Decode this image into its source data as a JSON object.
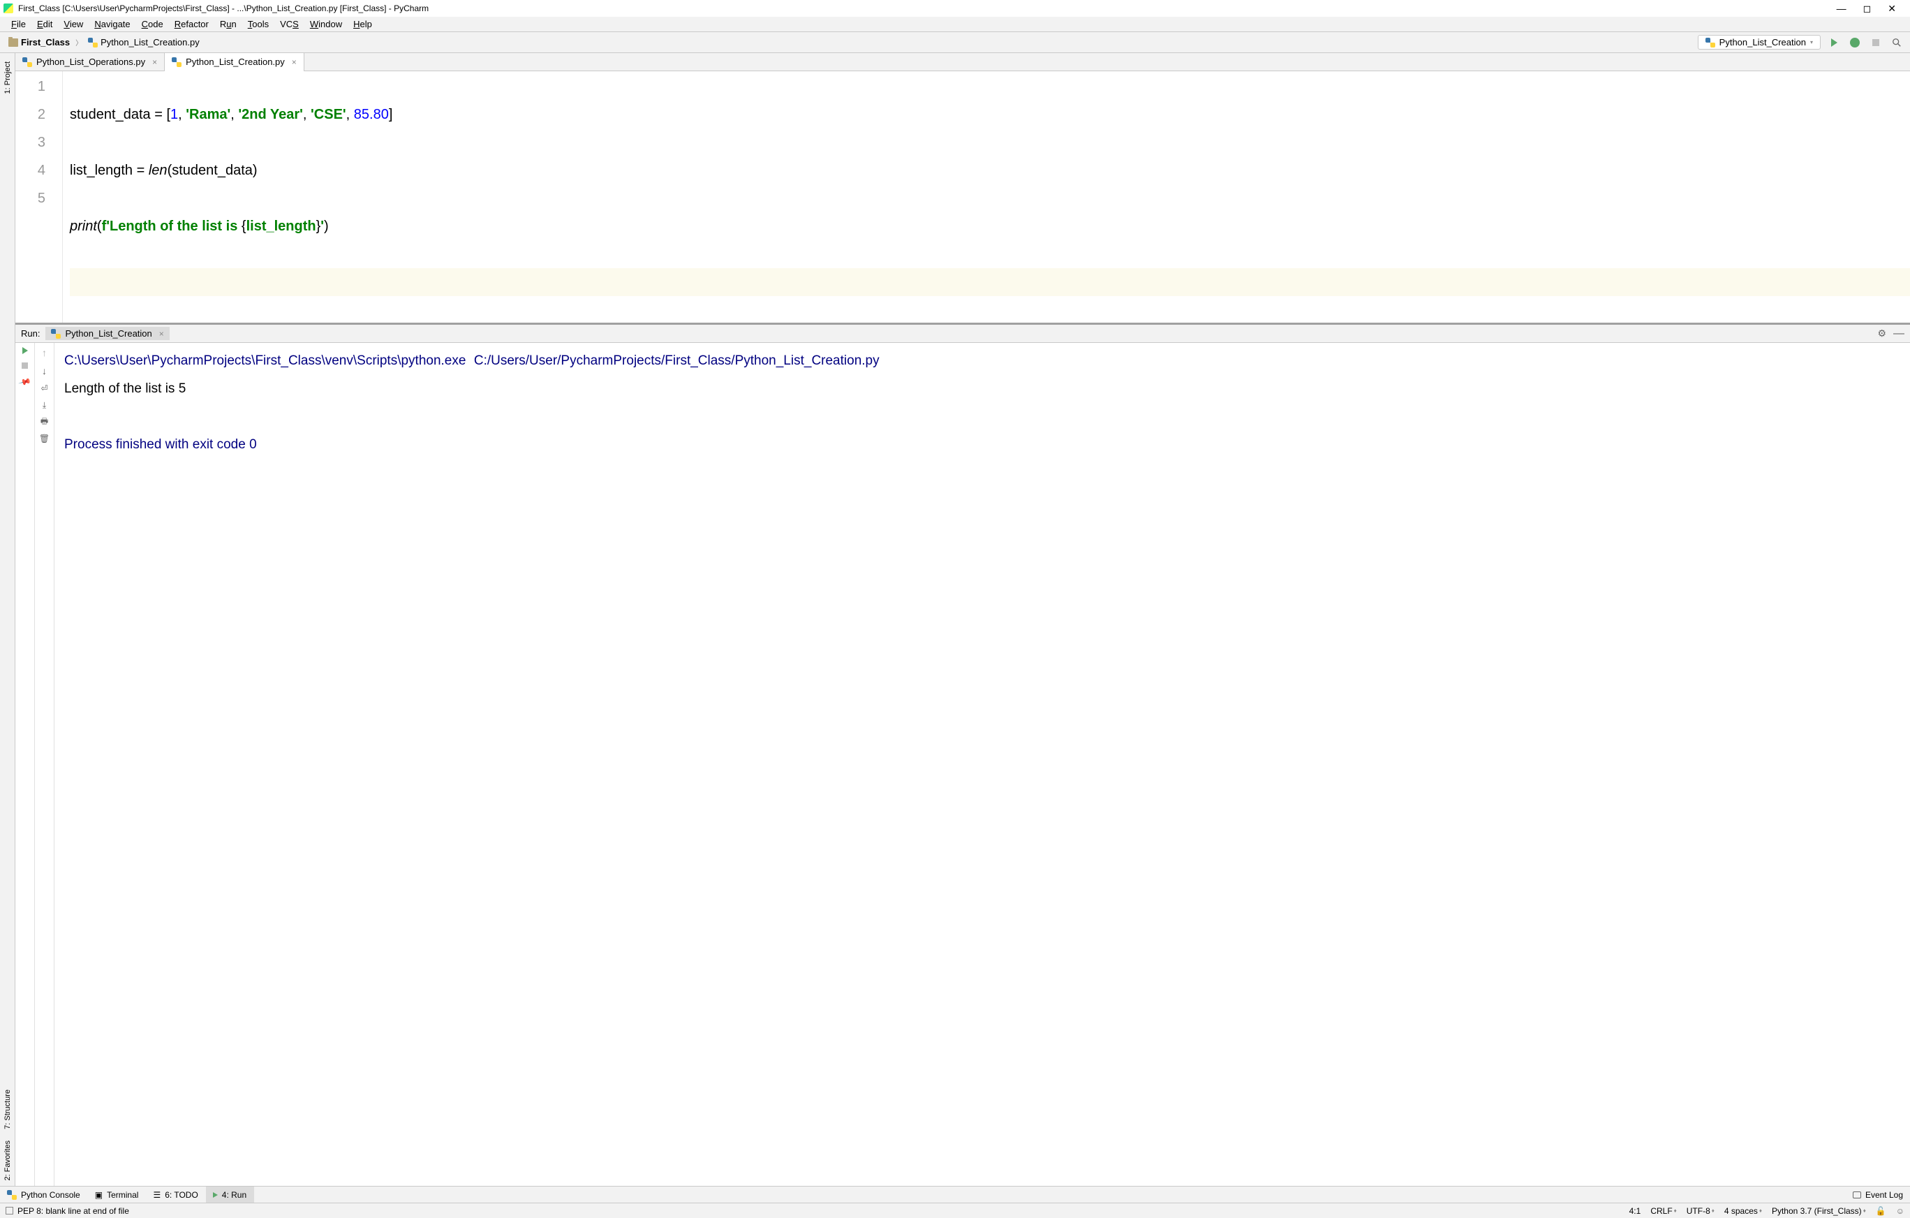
{
  "titlebar": {
    "text": "First_Class [C:\\Users\\User\\PycharmProjects\\First_Class] - ...\\Python_List_Creation.py [First_Class] - PyCharm"
  },
  "menu": {
    "items": [
      "File",
      "Edit",
      "View",
      "Navigate",
      "Code",
      "Refactor",
      "Run",
      "Tools",
      "VCS",
      "Window",
      "Help"
    ]
  },
  "breadcrumb": {
    "project": "First_Class",
    "file": "Python_List_Creation.py"
  },
  "run_config": {
    "label": "Python_List_Creation"
  },
  "sidebar_left": {
    "project": "1: Project",
    "structure": "7: Structure",
    "favorites": "2: Favorites"
  },
  "editor_tabs": [
    {
      "name": "Python_List_Operations.py",
      "active": false
    },
    {
      "name": "Python_List_Creation.py",
      "active": true
    }
  ],
  "gutter": [
    "1",
    "2",
    "3",
    "4",
    "5"
  ],
  "run_panel": {
    "label": "Run:",
    "tab": "Python_List_Creation"
  },
  "console": {
    "exe_path": "C:\\Users\\User\\PycharmProjects\\First_Class\\venv\\Scripts\\python.exe",
    "script_path": "C:/Users/User/PycharmProjects/First_Class/Python_List_Creation.py",
    "output_line": "Length of the list is 5",
    "exit_line": "Process finished with exit code 0"
  },
  "bottom_tabs": {
    "python_console": "Python Console",
    "terminal": "Terminal",
    "todo": "6: TODO",
    "run": "4: Run",
    "event_log": "Event Log"
  },
  "statusbar": {
    "message": "PEP 8: blank line at end of file",
    "position": "4:1",
    "line_sep": "CRLF",
    "encoding": "UTF-8",
    "indent": "4 spaces",
    "interpreter": "Python 3.7 (First_Class)"
  },
  "chart_data": {
    "type": "table",
    "title": "Editor code content",
    "lines": [
      {
        "ln": 1,
        "text": "student_data = [1, 'Rama', '2nd Year', 'CSE', 85.80]"
      },
      {
        "ln": 2,
        "text": "list_length = len(student_data)"
      },
      {
        "ln": 3,
        "text": "print(f'Length of the list is {list_length}')"
      },
      {
        "ln": 4,
        "text": ""
      },
      {
        "ln": 5,
        "text": ""
      }
    ]
  }
}
